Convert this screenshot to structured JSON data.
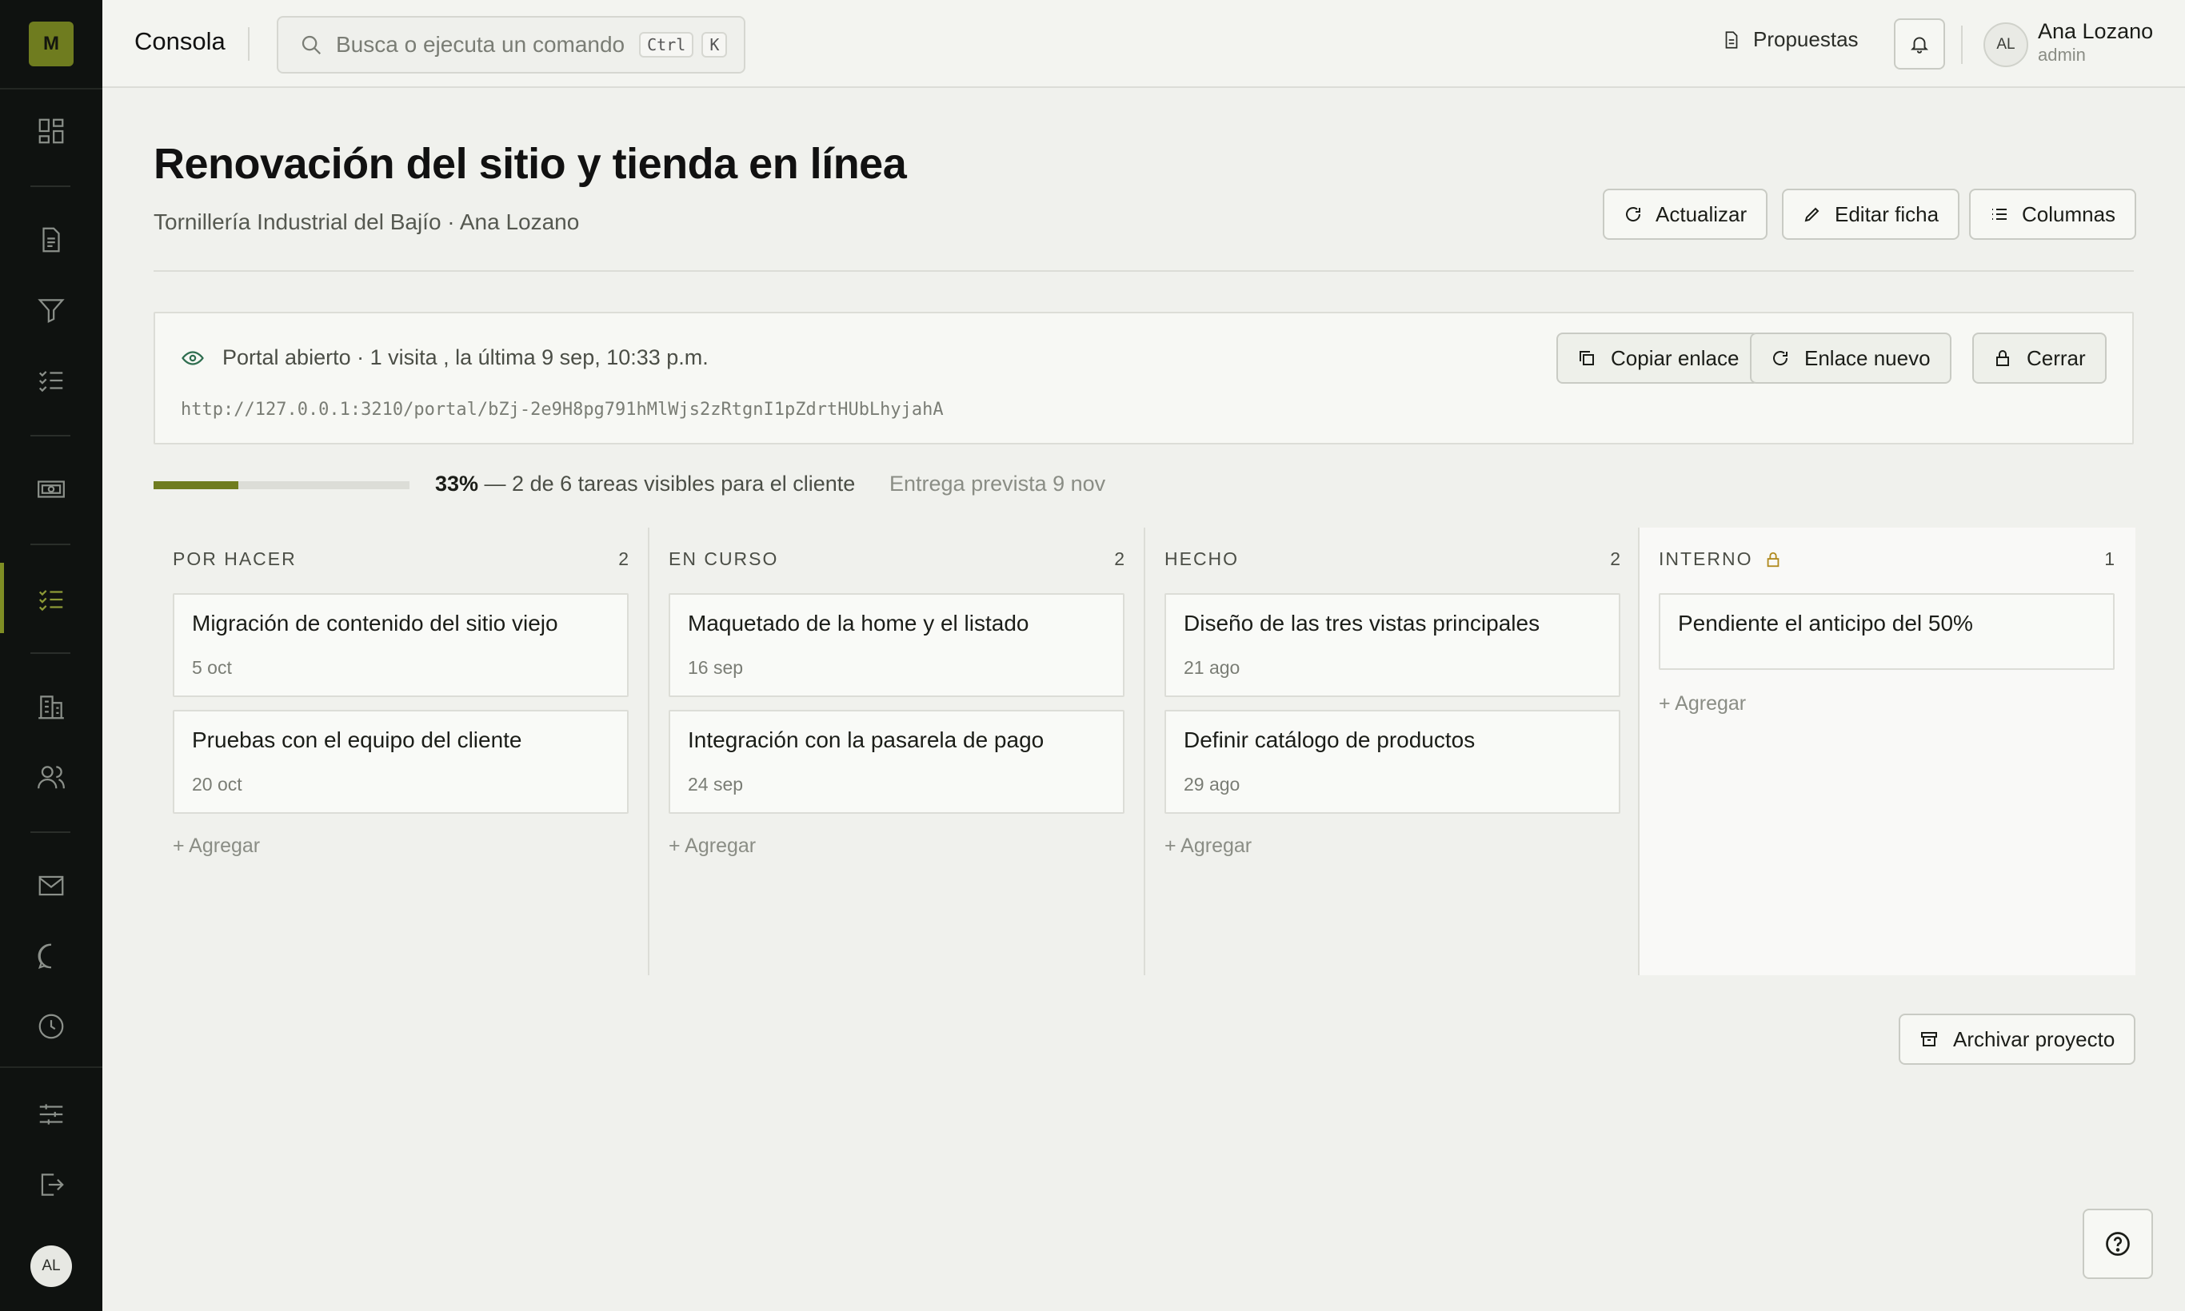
{
  "sidebar": {
    "logo": "M",
    "avatar": "AL"
  },
  "topbar": {
    "brand": "Consola",
    "search_placeholder": "Busca o ejecuta un comando",
    "kbd_ctrl": "Ctrl",
    "kbd_k": "K",
    "proposals": "Propuestas",
    "user_initials": "AL",
    "user_name": "Ana Lozano",
    "user_role": "admin"
  },
  "header": {
    "title": "Renovación del sitio y tienda en línea",
    "subtitle": "Tornillería Industrial del Bajío · Ana Lozano",
    "refresh": "Actualizar",
    "edit": "Editar ficha",
    "columns": "Columnas"
  },
  "portal": {
    "status": "Portal abierto · 1 visita , la última 9 sep, 10:33 p.m.",
    "url": "http://127.0.0.1:3210/portal/bZj-2e9H8pg791hMlWjs2zRtgnI1pZdrtHUbLhyjahA",
    "copy": "Copiar enlace",
    "new_link": "Enlace nuevo",
    "close": "Cerrar"
  },
  "progress": {
    "percent": 33,
    "percent_label": "33%",
    "text": " — 2 de 6 tareas visibles para el cliente",
    "delivery": "Entrega prevista 9 nov"
  },
  "board": {
    "add_label": "+ Agregar",
    "columns": [
      {
        "name": "POR HACER",
        "count": "2",
        "cards": [
          {
            "title": "Migración de contenido del sitio viejo",
            "date": "5 oct"
          },
          {
            "title": "Pruebas con el equipo del cliente",
            "date": "20 oct"
          }
        ]
      },
      {
        "name": "EN CURSO",
        "count": "2",
        "cards": [
          {
            "title": "Maquetado de la home y el listado",
            "date": "16 sep"
          },
          {
            "title": "Integración con la pasarela de pago",
            "date": "24 sep"
          }
        ]
      },
      {
        "name": "HECHO",
        "count": "2",
        "cards": [
          {
            "title": "Diseño de las tres vistas principales",
            "date": "21 ago"
          },
          {
            "title": "Definir catálogo de productos",
            "date": "29 ago"
          }
        ]
      },
      {
        "name": "INTERNO",
        "count": "1",
        "cards": [
          {
            "title": "Pendiente el anticipo del 50%"
          }
        ]
      }
    ]
  },
  "footer": {
    "archive": "Archivar proyecto"
  },
  "colors": {
    "accent": "#6f7c1f",
    "sidebar_bg": "#0f1210",
    "page_bg": "#f0f1ed",
    "eye_icon": "#2f6e4f",
    "lock_icon": "#b08a1e"
  }
}
